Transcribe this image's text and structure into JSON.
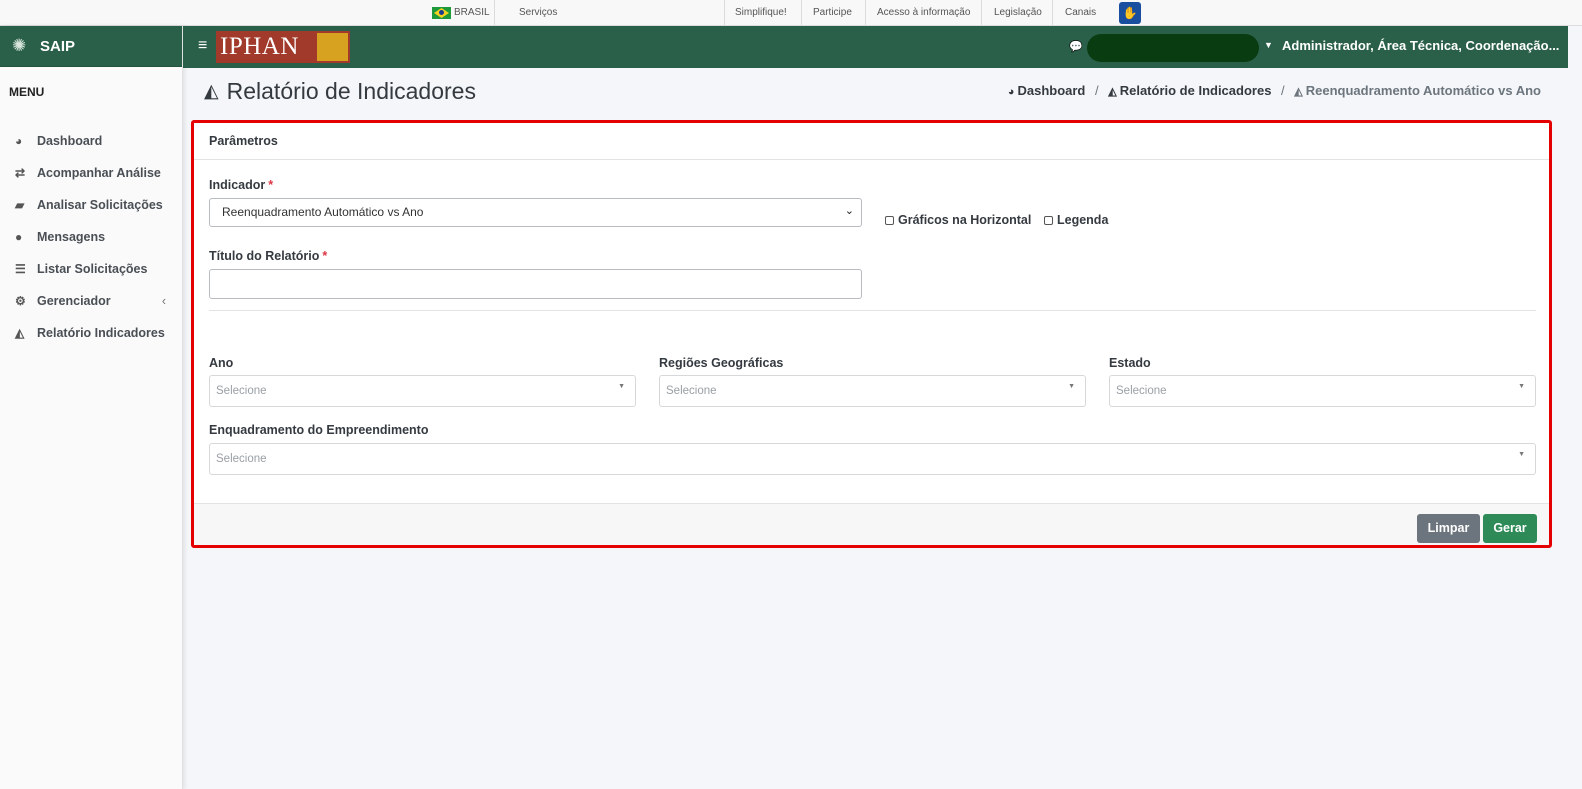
{
  "gov_bar": {
    "country": "BRASIL",
    "items": [
      "Serviços",
      "Simplifique!",
      "Participe",
      "Acesso à informação",
      "Legislação",
      "Canais"
    ]
  },
  "sidebar": {
    "brand": "SAIP",
    "menu_title": "MENU",
    "items": [
      {
        "label": "Dashboard",
        "icon": "dashboard-icon"
      },
      {
        "label": "Acompanhar Análise",
        "icon": "exchange-icon"
      },
      {
        "label": "Analisar Solicitações",
        "icon": "book-icon"
      },
      {
        "label": "Mensagens",
        "icon": "comments-icon"
      },
      {
        "label": "Listar Solicitações",
        "icon": "list-icon"
      },
      {
        "label": "Gerenciador",
        "icon": "cogs-icon"
      },
      {
        "label": "Relatório Indicadores",
        "icon": "area-chart-icon"
      }
    ]
  },
  "header": {
    "logo_text": "IPHAN",
    "user_role": "Administrador, Área Técnica, Coordenação..."
  },
  "page": {
    "title": "Relatório de Indicadores",
    "breadcrumb": [
      "Dashboard",
      "Relatório de Indicadores",
      "Reenquadramento Automático vs Ano"
    ]
  },
  "form": {
    "card_title": "Parâmetros",
    "indicador_label": "Indicador",
    "indicador_value": "Reenquadramento Automático vs Ano",
    "checkbox_horizontal": "Gráficos na Horizontal",
    "checkbox_legenda": "Legenda",
    "titulo_label": "Título do Relatório",
    "titulo_value": "",
    "ano_label": "Ano",
    "regioes_label": "Regiões Geográficas",
    "estado_label": "Estado",
    "enquadramento_label": "Enquadramento do Empreendimento",
    "placeholder": "Selecione",
    "btn_limpar": "Limpar",
    "btn_gerar": "Gerar"
  },
  "colors": {
    "header_green": "#2a6049",
    "highlight": "#e40000",
    "gerar": "#2e8b57",
    "limpar": "#6c757d"
  }
}
